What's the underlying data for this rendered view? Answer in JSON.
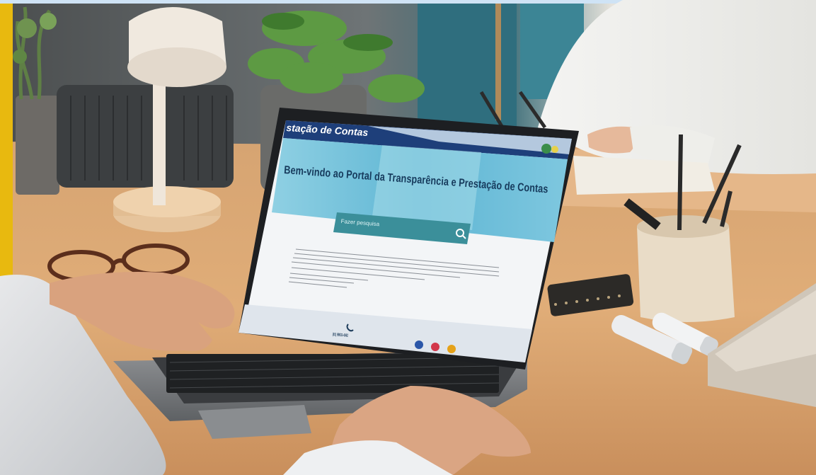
{
  "photo": {
    "description_tag": "person-using-laptop"
  },
  "portal": {
    "header_title": "stação de Contas",
    "welcome_title": "Bem-vindo ao Portal da Transparência e Prestação de Contas",
    "search_placeholder": "Fazer pesquisa",
    "phone": "(81) 99831-4062"
  },
  "colors": {
    "accent_yellow": "#e8b90f",
    "portal_header": "#1e3f7a",
    "portal_banner": "#6cc3dd",
    "search_box": "#3b8f9a"
  },
  "icons": [
    "search-icon",
    "phone-icon",
    "facebook-icon",
    "instagram-icon",
    "email-icon"
  ]
}
